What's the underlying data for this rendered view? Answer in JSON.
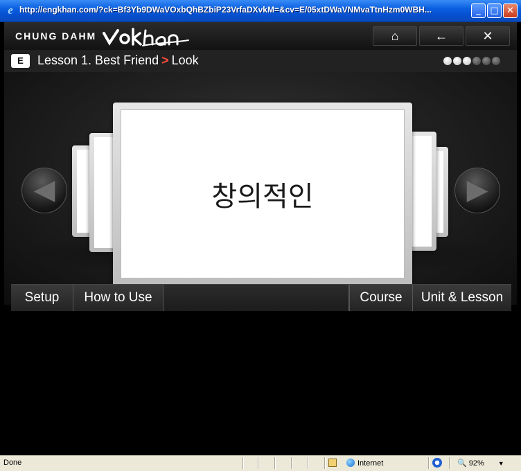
{
  "window": {
    "title": "http://engkhan.com/?ck=Bf3Yb9DWaVOxbQhBZbiP23VrfaDXvkM=&cv=E/05xtDWaVNMvaTtnHzm0WBH...",
    "min_icon": "minimize-icon",
    "max_icon": "maximize-icon",
    "close_icon": "close-icon"
  },
  "topbar": {
    "brand": "CHUNG DAHM",
    "logo_text": "vokhan",
    "home_icon": "⌂",
    "back_icon": "←",
    "exit_icon": "✕"
  },
  "lesson": {
    "badge": "E",
    "title": "Lesson 1. Best Friend",
    "separator": ">",
    "section": "Look",
    "progress_dots": [
      true,
      true,
      true,
      false,
      false,
      false
    ]
  },
  "card": {
    "word": "창의적인"
  },
  "nav": {
    "prev_icon": "◀",
    "next_icon": "▶"
  },
  "menu": {
    "setup": "Setup",
    "how_to_use": "How to Use",
    "course": "Course",
    "unit_lesson": "Unit & Lesson"
  },
  "statusbar": {
    "status": "Done",
    "zone": "Internet",
    "zoom": "92%",
    "dropdown": "▼"
  },
  "colors": {
    "accent_separator": "#ff4b3a",
    "xp_title": "#0a5fe0",
    "status_bg": "#ece9d8"
  }
}
